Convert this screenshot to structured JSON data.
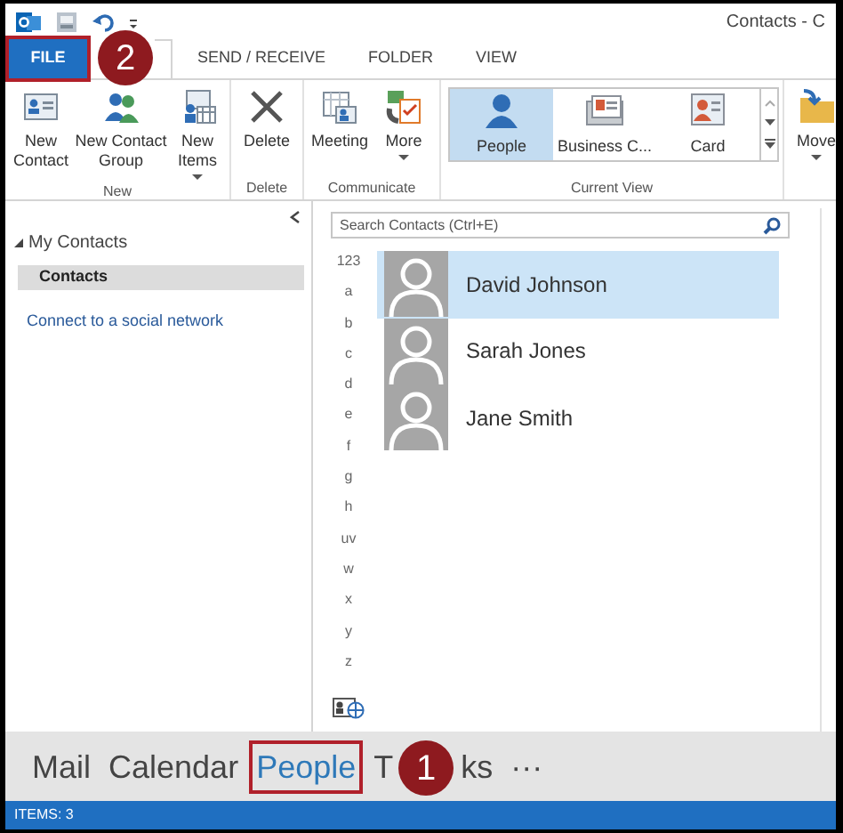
{
  "title_bar": {
    "title": "Contacts - C"
  },
  "ribbon_tabs": [
    {
      "label": "FILE",
      "kind": "file",
      "outlined": true
    },
    {
      "label": "SEND / RECEIVE",
      "kind": "tab",
      "outlined": false
    },
    {
      "label": "FOLDER",
      "kind": "tab",
      "outlined": false
    },
    {
      "label": "VIEW",
      "kind": "tab",
      "outlined": false
    }
  ],
  "ribbon_groups": [
    {
      "label": "New",
      "kind": "buttons",
      "buttons": [
        {
          "label": "New Contact",
          "dropdown": false
        },
        {
          "label": "New Contact Group",
          "dropdown": false
        },
        {
          "label": "New Items",
          "dropdown": true
        }
      ]
    },
    {
      "label": "Delete",
      "kind": "buttons",
      "buttons": [
        {
          "label": "Delete",
          "dropdown": false
        }
      ]
    },
    {
      "label": "Communicate",
      "kind": "buttons",
      "buttons": [
        {
          "label": "Meeting",
          "dropdown": false
        },
        {
          "label": "More",
          "dropdown": true
        }
      ]
    },
    {
      "label": "Current View",
      "kind": "gallery",
      "buttons": [
        {
          "label": "People",
          "selected": true
        },
        {
          "label": "Business C...",
          "selected": false
        },
        {
          "label": "Card",
          "selected": false
        }
      ]
    },
    {
      "kind": "buttons",
      "buttons": [
        {
          "label": "Move",
          "dropdown": true
        }
      ]
    }
  ],
  "folder_pane": {
    "group": {
      "label": "My Contacts",
      "expanded": true,
      "children": [
        {
          "label": "Contacts",
          "selected": true
        }
      ]
    },
    "link": "Connect to a social network"
  },
  "search": {
    "placeholder": "Search Contacts (Ctrl+E)"
  },
  "index_letters": [
    "123",
    "a",
    "b",
    "c",
    "d",
    "e",
    "f",
    "g",
    "h",
    "uv",
    "w",
    "x",
    "y",
    "z"
  ],
  "contacts": [
    {
      "name": "David Johnson",
      "selected": true
    },
    {
      "name": "Sarah Jones",
      "selected": false
    },
    {
      "name": "Jane Smith",
      "selected": false
    }
  ],
  "nav": [
    {
      "label": "Mail",
      "selected": false,
      "outlined": false
    },
    {
      "label": "Calendar",
      "selected": false,
      "outlined": false
    },
    {
      "label": "People",
      "selected": true,
      "outlined": true
    },
    {
      "label_parts": [
        "T",
        "ks"
      ],
      "kind": "covered",
      "selected": false,
      "outlined": false
    },
    {
      "label": "···",
      "selected": false,
      "outlined": false
    }
  ],
  "callouts": [
    {
      "number": "2"
    },
    {
      "number": "1"
    }
  ],
  "status_bar": {
    "text": "ITEMS: 3"
  }
}
